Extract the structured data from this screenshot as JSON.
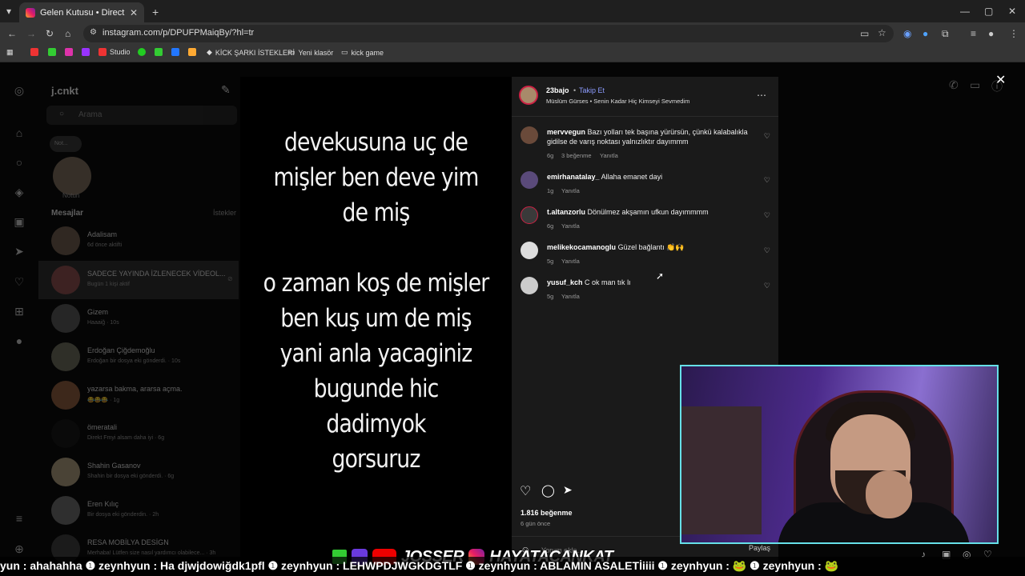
{
  "browser": {
    "tab_title": "Gelen Kutusu • Direct",
    "url": "instagram.com/p/DPUFPMaiqBy/?hl=tr",
    "bookmarks": [
      "Studio",
      "KİCK ŞARKI İSTEKLERİ",
      "Yeni klasör",
      "kick game"
    ]
  },
  "dm_panel": {
    "username": "j.cnkt",
    "search_placeholder": "Arama",
    "note_label": "Notun",
    "note_bubble": "Not...",
    "messages_header": "Mesajlar",
    "requests_link": "İstekler",
    "conversations": [
      {
        "name": "Adalisam",
        "sub": "6d önce aktifti"
      },
      {
        "name": "SADECE YAYINDA İZLENECEK VİDEOL...",
        "sub": "Bugün 1 kişi aktif"
      },
      {
        "name": "Gizem",
        "sub": "Haaaiğ · 10s"
      },
      {
        "name": "Erdoğan Çiğdemoğlu",
        "sub": "Erdoğan bir dosya eki gönderdi. · 10s"
      },
      {
        "name": "yazarsa bakma, ararsa açma.",
        "sub": "😂😂😂 · 1g"
      },
      {
        "name": "ömeratali",
        "sub": "Direkt Fmyi alsam daha iyi · 6g"
      },
      {
        "name": "Shahin Gasanov",
        "sub": "Shahin bir dosya eki gönderdi. · 6g"
      },
      {
        "name": "Eren Kılıç",
        "sub": "Bir dosya eki gönderdin. · 2h"
      },
      {
        "name": "RESA MOBİLYA DESİGN",
        "sub": "Merhaba! Lütfen size nasıl yardımcı olabilece... · 3h"
      }
    ]
  },
  "post": {
    "caption_lines": [
      "devekusuna uç de",
      "mişler ben deve yim",
      "de miş",
      "",
      "o zaman koş de mişler",
      "ben kuş um de miş",
      "yani anla yacaginiz",
      "bugunde hic",
      "dadimyok",
      "gorsuruz"
    ]
  },
  "comments_panel": {
    "author": "23bajo",
    "follow": "Takip Et",
    "separator": "•",
    "audio": "Müslüm Gürses • Senin Kadar Hiç Kimseyi Sevmedim",
    "comments": [
      {
        "user": "mervvegun",
        "text": "Bazı yolları tek başına yürürsün, çünkü kalabalıkla gidilse de varış noktası yalnızlıktır dayımmm",
        "age": "6g",
        "likes": "3 beğenme",
        "reply": "Yanıtla"
      },
      {
        "user": "emirhanatalay_",
        "text": "Allaha emanet dayi",
        "age": "1g",
        "likes": "",
        "reply": "Yanıtla"
      },
      {
        "user": "t.altanzorlu",
        "text": "Dönülmez akşamın ufkun dayımmmm",
        "age": "6g",
        "likes": "",
        "reply": "Yanıtla"
      },
      {
        "user": "melikekocamanoglu",
        "text": "Güzel bağlantı 👏🙌",
        "age": "5g",
        "likes": "",
        "reply": "Yanıtla"
      },
      {
        "user": "yusuf_kch",
        "text": "C ok man tık lı",
        "age": "5g",
        "likes": "",
        "reply": "Yanıtla"
      }
    ],
    "likes_count": "1.816 beğenme",
    "posted": "6 gün önce",
    "comment_placeholder": "Yorum ekle...",
    "share_label": "Paylaş"
  },
  "overlay": {
    "brands": [
      "JOSSER",
      "HAYATACANKAT"
    ],
    "ticker": "yun : ahahahha  ❶ zeynhyun : Ha djwjdowiğdk1pfl  ❶ zeynhyun : LEHWPDJWGKDGTLF  ❶ zeynhyun : ABLAMIN ASALETİiiii  ❶ zeynhyun : 🐸  ❶ zeynhyun : 🐸"
  },
  "colors": {
    "accent_follow": "#8c9cff",
    "webcam_border": "#66e0e8",
    "ticker_bg": "#000000"
  }
}
